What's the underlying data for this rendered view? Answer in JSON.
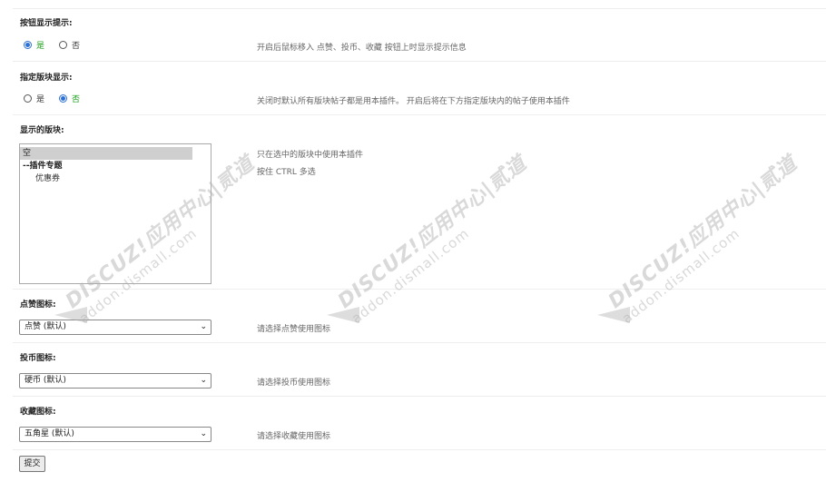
{
  "sections": {
    "button_hint": {
      "label": "按钮显示提示:",
      "options": [
        "是",
        "否"
      ],
      "selected": "是",
      "hint": "开启后鼠标移入 点赞、投币、收藏 按钮上时显示提示信息"
    },
    "specify_forum": {
      "label": "指定版块显示:",
      "options": [
        "是",
        "否"
      ],
      "selected": "否",
      "hint": "关闭时默认所有版块帖子都是用本插件。 开启后将在下方指定版块内的帖子使用本插件"
    },
    "display_forums": {
      "label": "显示的版块:",
      "items": [
        "空",
        "--插件专题",
        "优惠券"
      ],
      "selected": "空",
      "hint_line1": "只在选中的版块中使用本插件",
      "hint_line2": "按住 CTRL 多选"
    },
    "like_icon": {
      "label": "点赞图标:",
      "value": "点赞 (默认)",
      "hint": "请选择点赞使用图标"
    },
    "coin_icon": {
      "label": "投币图标:",
      "value": "硬币 (默认)",
      "hint": "请选择投币使用图标"
    },
    "fav_icon": {
      "label": "收藏图标:",
      "value": "五角星 (默认)",
      "hint": "请选择收藏使用图标"
    }
  },
  "submit_label": "提交",
  "watermark": {
    "brand": "DISCUZ!应用中心|贰道",
    "domain": "addon.dismall.com"
  },
  "colors": {
    "accent": "#2c6fd6",
    "active_option": "#1aa01a",
    "hint_text": "#666666"
  }
}
